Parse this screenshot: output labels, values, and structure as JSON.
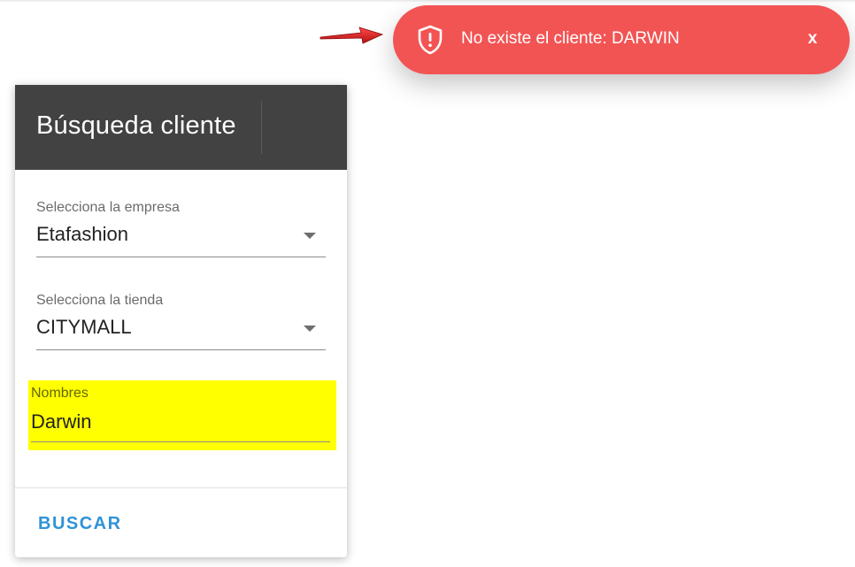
{
  "card": {
    "title": "Búsqueda cliente",
    "empresa": {
      "label": "Selecciona la empresa",
      "value": "Etafashion"
    },
    "tienda": {
      "label": "Selecciona la tienda",
      "value": "CITYMALL"
    },
    "nombres": {
      "label": "Nombres",
      "value": "Darwin"
    },
    "search_label": "BUSCAR"
  },
  "toast": {
    "message": "No existe el cliente: DARWIN",
    "close_label": "x",
    "icon": "shield-alert-icon"
  },
  "colors": {
    "header_bg": "#424242",
    "toast_bg": "#f25454",
    "highlight": "#ffff00",
    "button_accent": "#2f93d6",
    "arrow": "#e02020"
  }
}
